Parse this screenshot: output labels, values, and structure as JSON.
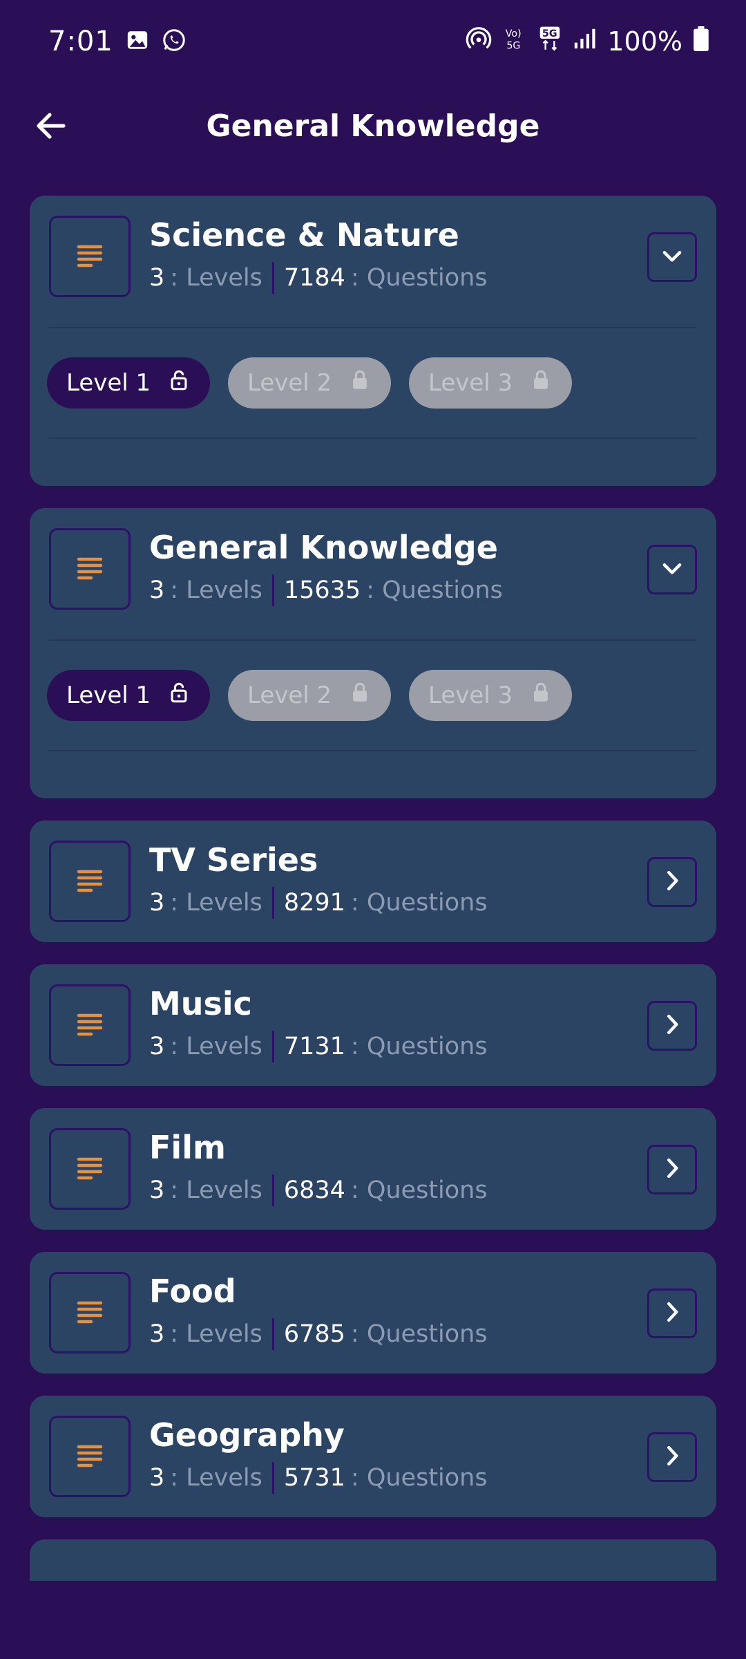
{
  "status_bar": {
    "time": "7:01",
    "battery": "100%",
    "icons": [
      "gallery-icon",
      "whatsapp-icon",
      "hotspot-icon",
      "volte-icon",
      "5g-icon",
      "signal-icon",
      "battery-icon"
    ]
  },
  "app_bar": {
    "title": "General Knowledge",
    "back_icon": "arrow-left-icon"
  },
  "colors": {
    "background": "#2A0E56",
    "card": "#2B4464",
    "accent": "#E8903C",
    "muted_text": "#8A9BB2",
    "locked_pill": "#9B9EA6"
  },
  "categories": [
    {
      "title": "Science & Nature",
      "levels": "3",
      "levels_label": ": Levels",
      "questions": "7184",
      "questions_label": ": Questions",
      "expanded": true,
      "level_pills": [
        {
          "label": "Level 1",
          "locked": false
        },
        {
          "label": "Level 2",
          "locked": true
        },
        {
          "label": "Level 3",
          "locked": true
        }
      ]
    },
    {
      "title": "General Knowledge",
      "levels": "3",
      "levels_label": ": Levels",
      "questions": "15635",
      "questions_label": ": Questions",
      "expanded": true,
      "level_pills": [
        {
          "label": "Level 1",
          "locked": false
        },
        {
          "label": "Level 2",
          "locked": true
        },
        {
          "label": "Level 3",
          "locked": true
        }
      ]
    },
    {
      "title": "TV Series",
      "levels": "3",
      "levels_label": ": Levels",
      "questions": "8291",
      "questions_label": ": Questions",
      "expanded": false
    },
    {
      "title": "Music",
      "levels": "3",
      "levels_label": ": Levels",
      "questions": "7131",
      "questions_label": ": Questions",
      "expanded": false
    },
    {
      "title": "Film",
      "levels": "3",
      "levels_label": ": Levels",
      "questions": "6834",
      "questions_label": ": Questions",
      "expanded": false
    },
    {
      "title": "Food",
      "levels": "3",
      "levels_label": ": Levels",
      "questions": "6785",
      "questions_label": ": Questions",
      "expanded": false
    },
    {
      "title": "Geography",
      "levels": "3",
      "levels_label": ": Levels",
      "questions": "5731",
      "questions_label": ": Questions",
      "expanded": false
    }
  ]
}
